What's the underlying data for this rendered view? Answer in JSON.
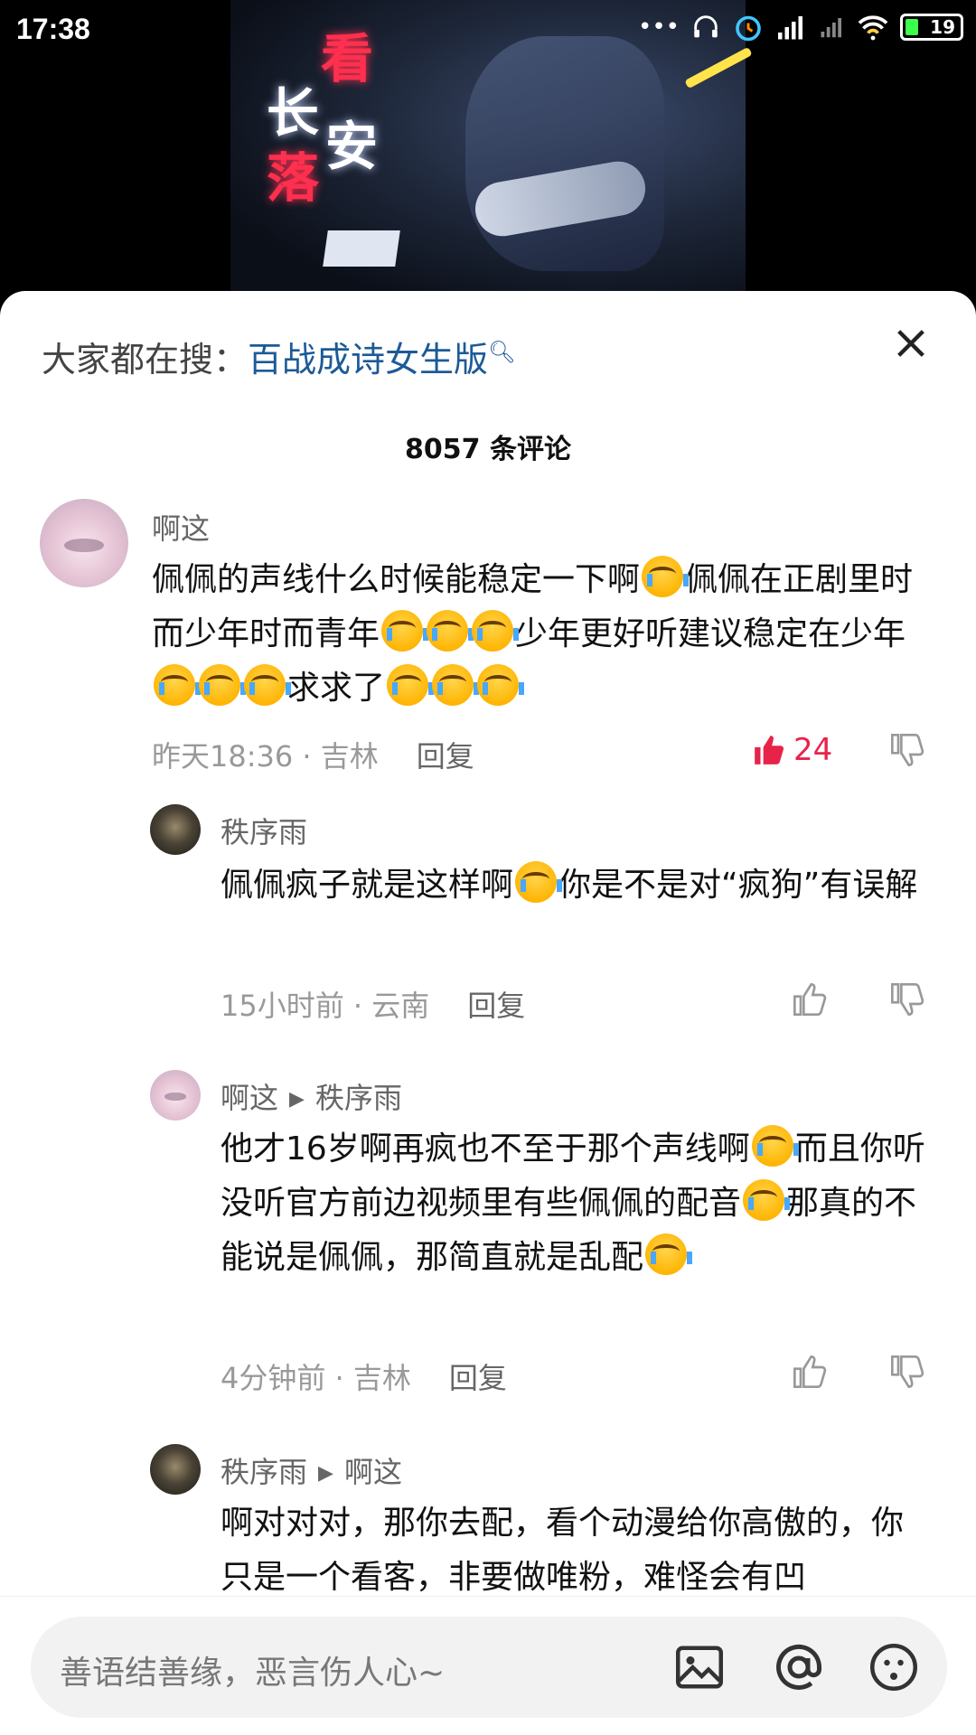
{
  "status_bar": {
    "time": "17:38",
    "battery": "19"
  },
  "video": {
    "title_chars": [
      "看",
      "长",
      "安",
      "落"
    ]
  },
  "sheet": {
    "search_hint_label": "大家都在搜：",
    "search_hint_keyword": "百战成诗女生版",
    "comment_count": "8057 条评论"
  },
  "comments": [
    {
      "user": "啊这",
      "text_parts": [
        "佩佩的声线什么时候能稳定一下啊",
        "佩佩在正剧里时而少年时而青年",
        "少年更好听建议稳定在少年",
        "求求了"
      ],
      "meta": "昨天18:36 · 吉林",
      "reply": "回复",
      "likes": "24"
    },
    {
      "user": "秩序雨",
      "text_parts": [
        "佩佩疯子就是这样啊",
        "你是不是对“疯狗”有误解"
      ],
      "meta": "15小时前 · 云南",
      "reply": "回复"
    },
    {
      "user": "啊这",
      "reply_to": "秩序雨",
      "text_parts": [
        "他才16岁啊再疯也不至于那个声线啊",
        "而且你听没听官方前边视频里有些佩佩的配音",
        "那真的不能说是佩佩，那简直就是乱配"
      ],
      "meta": "4分钟前 · 吉林",
      "reply": "回复"
    },
    {
      "user": "秩序雨",
      "reply_to": "啊这",
      "text": "啊对对对，那你去配，看个动漫给你高傲的，你只是一个看客，非要做唯粉，难怪会有凹"
    }
  ],
  "input_bar": {
    "placeholder": "善语结善缘，恶言伤人心~"
  },
  "colors": {
    "accent_link": "#1c5a97",
    "like_red": "#e8234a"
  }
}
